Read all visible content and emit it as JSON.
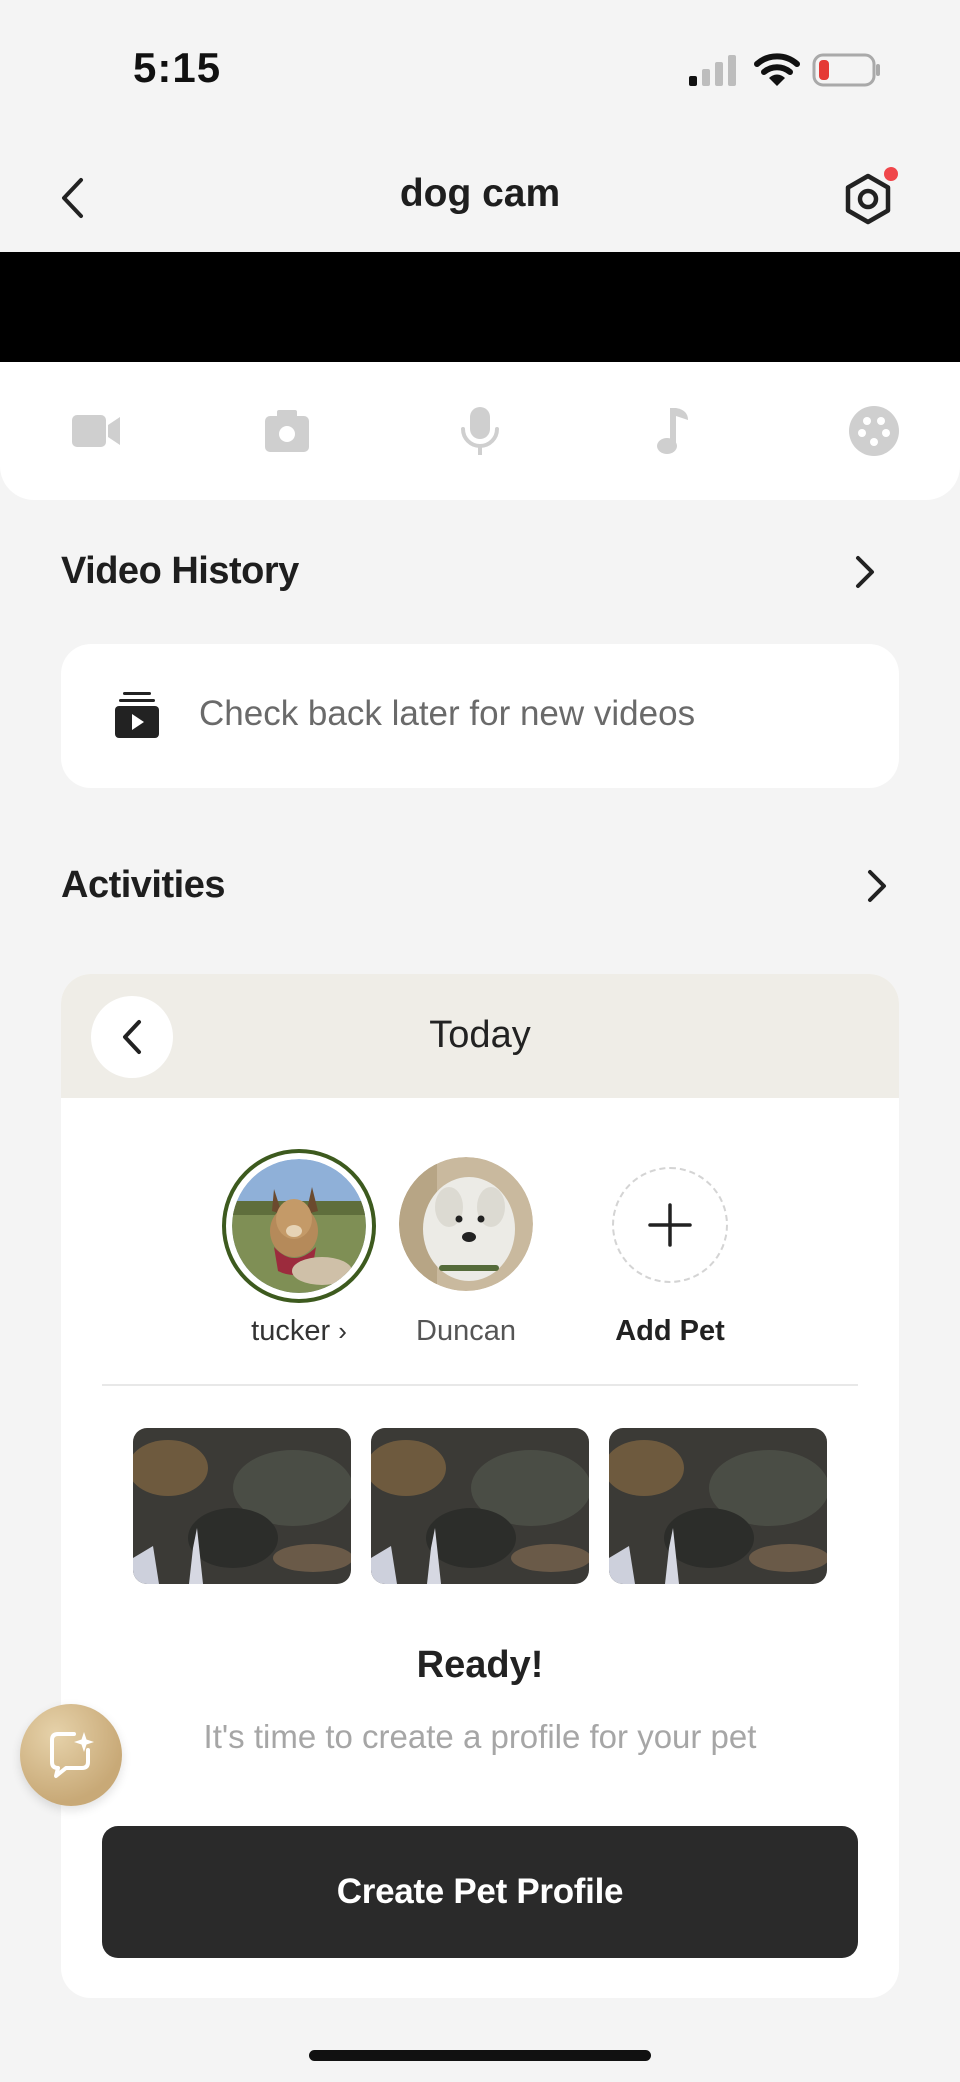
{
  "status_bar": {
    "time": "5:15"
  },
  "nav": {
    "title": "dog cam"
  },
  "toolbar": {
    "icons": [
      "video-camera-icon",
      "camera-snapshot-icon",
      "microphone-icon",
      "music-note-icon",
      "palette-icon"
    ]
  },
  "video_history": {
    "title": "Video History",
    "empty_message": "Check back later for new videos"
  },
  "activities": {
    "title": "Activities",
    "day_label": "Today",
    "pets": [
      {
        "name": "tucker",
        "selected": true
      },
      {
        "name": "Duncan",
        "selected": false
      }
    ],
    "add_pet_label": "Add Pet",
    "ready_title": "Ready!",
    "ready_subtitle": "It's time to create a profile for your pet",
    "create_button": "Create Pet Profile"
  },
  "colors": {
    "background": "#f4f4f4",
    "selected_ring": "#3d5a1e",
    "button_dark": "#2a2a2a",
    "notification_dot": "#f0464a",
    "battery_low": "#e53935",
    "assistant_fab": "#c8a977"
  }
}
